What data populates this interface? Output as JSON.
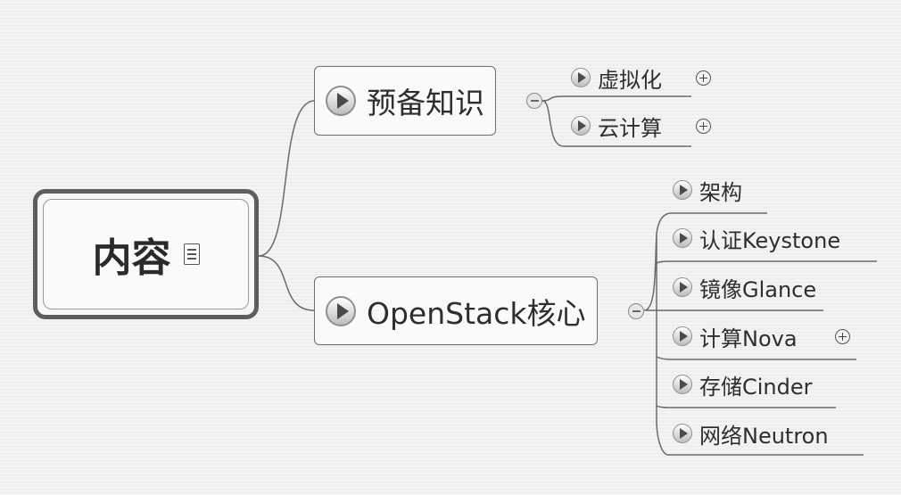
{
  "root": {
    "label": "内容"
  },
  "topics": [
    {
      "label": "预备知识",
      "children": [
        "虚拟化",
        "云计算"
      ]
    },
    {
      "label": "OpenStack核心",
      "children": [
        "架构",
        "认证Keystone",
        "镜像Glance",
        "计算Nova",
        "存储Cinder",
        "网络Neutron"
      ]
    }
  ],
  "icons": {
    "topic_marker": "play-icon",
    "root_marker": "note-icon",
    "collapse": "collapse-minus-icon",
    "expand": "expand-plus-icon"
  }
}
